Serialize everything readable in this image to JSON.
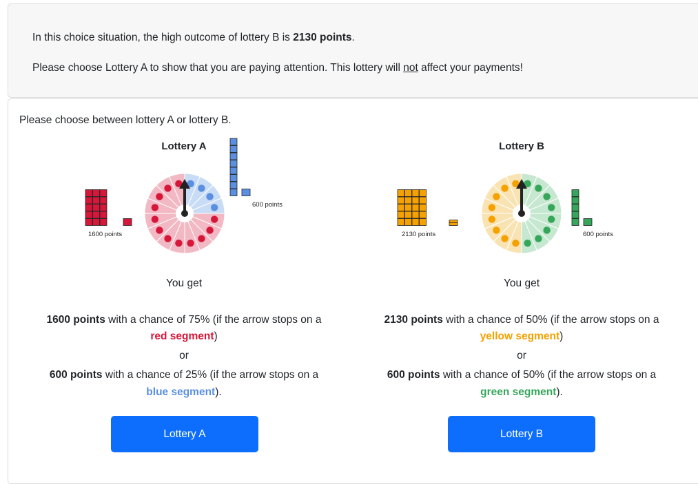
{
  "info": {
    "line1_pre": "In this choice situation, the high outcome of lottery B is ",
    "line1_bold": "2130 points",
    "line1_post": ".",
    "line2_pre": "Please choose Lottery A to show that you are paying attention. This lottery will ",
    "line2_under": "not",
    "line2_post": " affect your payments!"
  },
  "prompt": "Please choose between lottery A or lottery B.",
  "you_get": "You get",
  "or_text": "or",
  "lotteries": [
    {
      "title": "Lottery A",
      "high_label": "1600 points",
      "low_label": "600 points",
      "high_points": "1600 points",
      "high_chance_text": " with a chance of 75% (if the arrow stops on a",
      "high_color_name": "red segment",
      "high_close": ")",
      "low_points": "600 points",
      "low_chance_text": " with a chance of 25% (if the arrow stops on a",
      "low_color_name": "blue segment",
      "low_close": ").",
      "high_prob": 0.75,
      "low_prob": 0.25,
      "high_color": "#d6173a",
      "low_color": "#5b8fe0",
      "high_tint": "#f2b8c3",
      "low_tint": "#c9dcf5",
      "button_label": "Lottery A"
    },
    {
      "title": "Lottery B",
      "high_label": "2130 points",
      "low_label": "600 points",
      "high_points": "2130 points",
      "high_chance_text": " with a chance of 50% (if the arrow stops on a",
      "high_color_name": "yellow segment",
      "high_close": ")",
      "low_points": "600 points",
      "low_chance_text": " with a chance of 50% (if the arrow stops on a",
      "low_color_name": "green segment",
      "low_close": ").",
      "high_prob": 0.5,
      "low_prob": 0.5,
      "high_color": "#f5a100",
      "low_color": "#35a65a",
      "high_tint": "#f9e3b3",
      "low_tint": "#c6e7d0",
      "button_label": "Lottery B"
    }
  ]
}
